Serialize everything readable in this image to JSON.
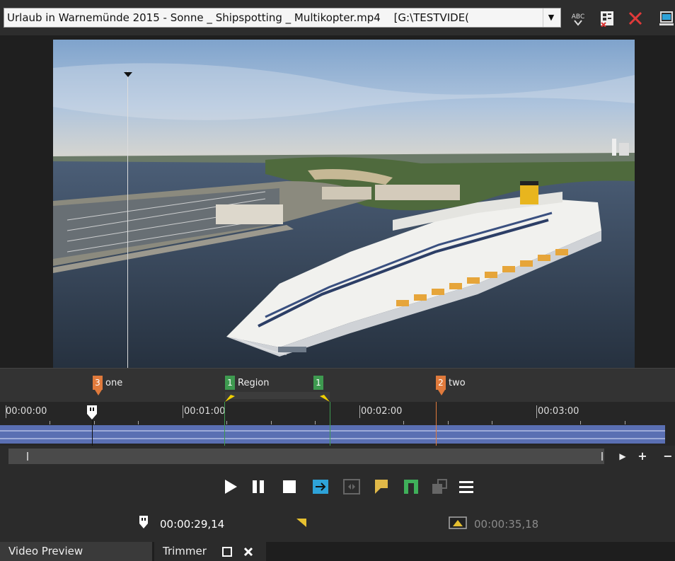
{
  "toolbar": {
    "file_name": "Urlaub in Warnemünde 2015 - Sonne _ Shipspotting _ Multikopter.mp4",
    "file_path": "[G:\\TESTVIDE(",
    "icons": [
      "dropdown-arrow-icon",
      "abc-icon",
      "properties-icon",
      "delete-icon",
      "window-icon"
    ]
  },
  "markers": [
    {
      "num": "3",
      "label": "one",
      "color": "#e07a3c"
    },
    {
      "num": "1",
      "label": "Region",
      "color": "#3e9a50"
    },
    {
      "num": "1",
      "label": "",
      "color": "#3e9a50"
    },
    {
      "num": "2",
      "label": "two",
      "color": "#e07a3c"
    }
  ],
  "timeline": {
    "ticks": [
      "00:00:00",
      "00:01:00",
      "00:02:00",
      "00:03:00"
    ]
  },
  "transport": {
    "buttons": [
      "play",
      "pause",
      "stop",
      "loop",
      "selection",
      "marker",
      "region",
      "snapshot",
      "menu"
    ]
  },
  "times": {
    "cursor": "00:00:29,14",
    "selection_length": "00:00:35,18"
  },
  "tabs": [
    "Video Preview",
    "Trimmer"
  ],
  "colors": {
    "orange_marker": "#e07a3c",
    "green_marker": "#3e9a50",
    "waveform": "#5a6fb3",
    "transport_accent": "#2ea3d9"
  }
}
